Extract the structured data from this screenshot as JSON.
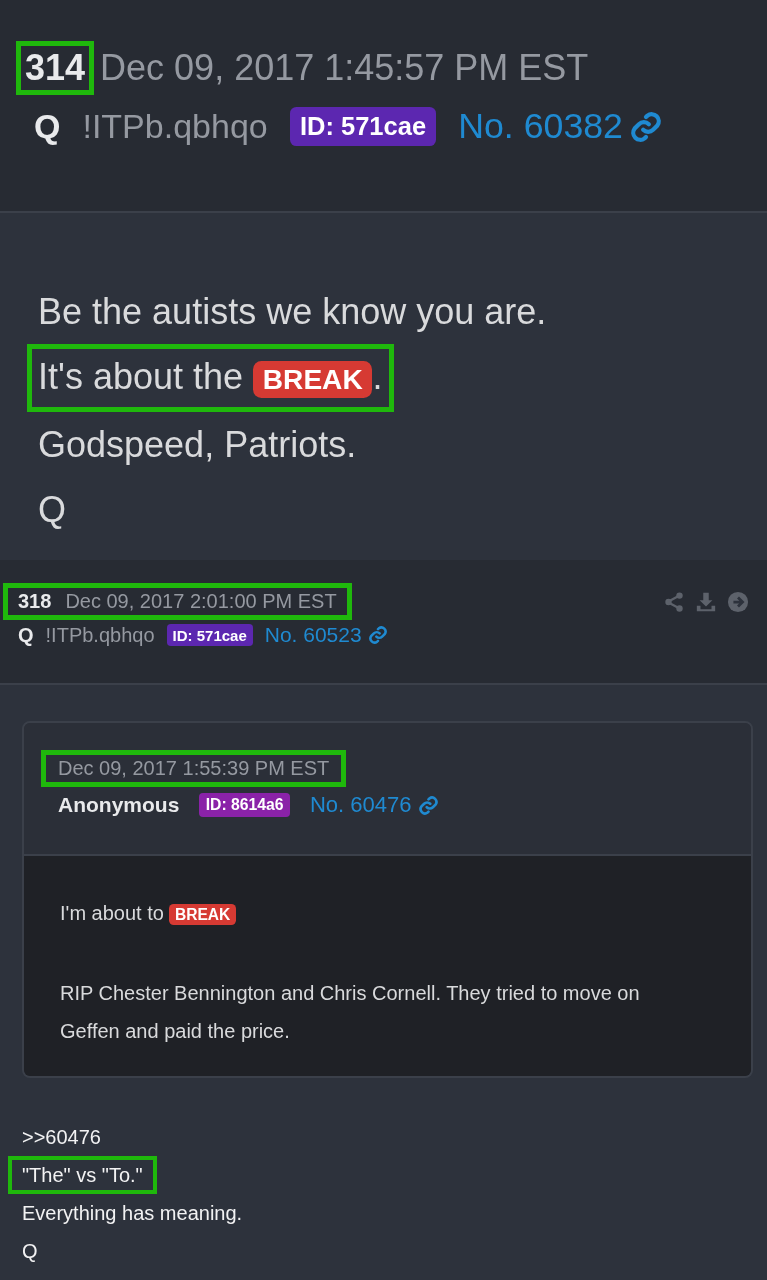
{
  "posts": [
    {
      "kind": "main",
      "number": "314",
      "number_highlighted": true,
      "header_highlighted": false,
      "date": "Dec 09, 2017 1:45:57 PM EST",
      "author": "Q",
      "tripcode": "!ITPb.qbhqo",
      "id_badge": {
        "text": "ID: 571cae",
        "color": "#5c27b0"
      },
      "post_no": "No. 60382",
      "body": [
        {
          "highlighted": false,
          "segments": [
            {
              "kind": "text",
              "text": "Be the autists we know you are."
            }
          ]
        },
        {
          "highlighted": true,
          "segments": [
            {
              "kind": "text",
              "text": "It's about the "
            },
            {
              "kind": "tag",
              "text": "BREAK"
            },
            {
              "kind": "text",
              "text": "."
            }
          ]
        },
        {
          "highlighted": false,
          "segments": [
            {
              "kind": "text",
              "text": "Godspeed, Patriots."
            }
          ]
        },
        {
          "highlighted": false,
          "segments": [
            {
              "kind": "text",
              "text": "Q"
            }
          ]
        }
      ]
    },
    {
      "kind": "reply",
      "number": "318",
      "number_highlighted": false,
      "header_highlighted": true,
      "date": "Dec 09, 2017 2:01:00 PM EST",
      "author": "Q",
      "tripcode": "!ITPb.qbhqo",
      "id_badge": {
        "text": "ID: 571cae",
        "color": "#5c27b0"
      },
      "post_no": "No. 60523",
      "quote": {
        "date": "Dec 09, 2017 1:55:39 PM EST",
        "date_highlighted": true,
        "author": "Anonymous",
        "id_badge": {
          "text": "ID: 8614a6",
          "color": "#8a22a8"
        },
        "post_no": "No. 60476",
        "body": [
          {
            "segments": [
              {
                "kind": "text",
                "text": "I'm about to "
              },
              {
                "kind": "tag",
                "text": "BREAK"
              }
            ]
          },
          {
            "segments": [
              {
                "kind": "text",
                "text": "RIP Chester Bennington and Chris Cornell. They tried to move on Geffen and paid the price."
              }
            ]
          }
        ]
      },
      "body": [
        {
          "highlighted": false,
          "segments": [
            {
              "kind": "text",
              "text": ">>60476"
            }
          ]
        },
        {
          "highlighted": true,
          "segments": [
            {
              "kind": "text",
              "text": "\"The\" vs \"To.\""
            }
          ]
        },
        {
          "highlighted": false,
          "segments": [
            {
              "kind": "text",
              "text": "Everything has meaning."
            }
          ]
        },
        {
          "highlighted": false,
          "segments": [
            {
              "kind": "text",
              "text": "Q"
            }
          ]
        }
      ]
    }
  ]
}
